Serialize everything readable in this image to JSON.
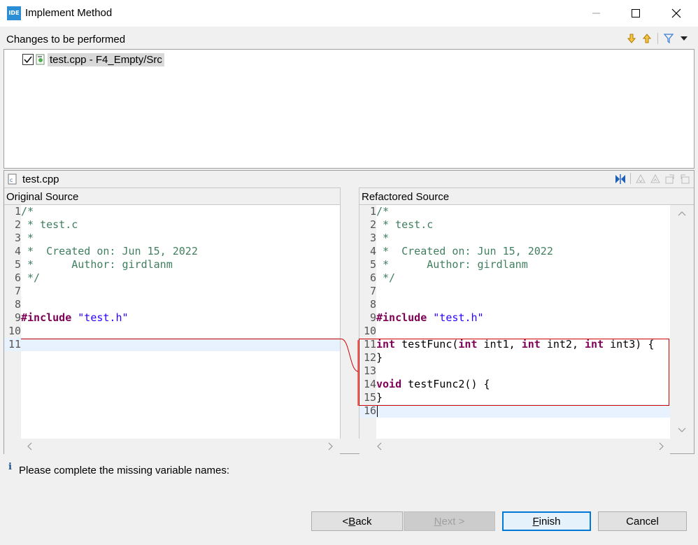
{
  "window": {
    "title": "Implement Method",
    "app_icon_text": "IDE"
  },
  "changes": {
    "header": "Changes to be performed",
    "items": [
      {
        "label": "test.cpp - F4_Empty/Src",
        "checked": true
      }
    ]
  },
  "compare": {
    "file_name": "test.cpp",
    "left_header": "Original Source",
    "right_header": "Refactored Source",
    "left_lines": [
      {
        "n": "1",
        "text": "/*",
        "type": "comment"
      },
      {
        "n": "2",
        "text": " * test.c",
        "type": "comment"
      },
      {
        "n": "3",
        "text": " *",
        "type": "comment"
      },
      {
        "n": "4",
        "text": " *  Created on: Jun 15, 2022",
        "type": "comment"
      },
      {
        "n": "5",
        "text": " *      Author: girdlanm",
        "type": "comment"
      },
      {
        "n": "6",
        "text": " */",
        "type": "comment"
      },
      {
        "n": "7",
        "text": "",
        "type": "plain"
      },
      {
        "n": "8",
        "text": "",
        "type": "plain"
      },
      {
        "n": "9",
        "kw": "#include",
        "str": " \"test.h\"",
        "type": "include"
      },
      {
        "n": "10",
        "text": "",
        "type": "plain"
      },
      {
        "n": "11",
        "text": "",
        "type": "plain",
        "highlight": true
      }
    ],
    "right_lines": [
      {
        "n": "1",
        "text": "/*",
        "type": "comment"
      },
      {
        "n": "2",
        "text": " * test.c",
        "type": "comment"
      },
      {
        "n": "3",
        "text": " *",
        "type": "comment"
      },
      {
        "n": "4",
        "text": " *  Created on: Jun 15, 2022",
        "type": "comment"
      },
      {
        "n": "5",
        "text": " *      Author: girdlanm",
        "type": "comment"
      },
      {
        "n": "6",
        "text": " */",
        "type": "comment"
      },
      {
        "n": "7",
        "text": "",
        "type": "plain"
      },
      {
        "n": "8",
        "text": "",
        "type": "plain"
      },
      {
        "n": "9",
        "kw": "#include",
        "str": " \"test.h\"",
        "type": "include"
      },
      {
        "n": "10",
        "text": "",
        "type": "plain"
      },
      {
        "n": "11",
        "type": "func",
        "parts": [
          [
            "kw",
            "int"
          ],
          [
            "p",
            " testFunc("
          ],
          [
            "kw",
            "int"
          ],
          [
            "p",
            " int1, "
          ],
          [
            "kw",
            "int"
          ],
          [
            "p",
            " int2, "
          ],
          [
            "kw",
            "int"
          ],
          [
            "p",
            " int3) {"
          ]
        ]
      },
      {
        "n": "12",
        "text": "}",
        "type": "plain"
      },
      {
        "n": "13",
        "text": "",
        "type": "plain"
      },
      {
        "n": "14",
        "type": "func",
        "parts": [
          [
            "kw",
            "void"
          ],
          [
            "p",
            " testFunc2() {"
          ]
        ]
      },
      {
        "n": "15",
        "text": "}",
        "type": "plain"
      },
      {
        "n": "16",
        "text": "",
        "type": "plain",
        "highlight": true
      }
    ]
  },
  "message": {
    "icon": "info-icon",
    "text": "Please complete the missing variable names:"
  },
  "buttons": {
    "back": {
      "pre": "< ",
      "mn": "B",
      "post": "ack"
    },
    "next": {
      "pre": "",
      "mn": "N",
      "post": "ext >"
    },
    "finish": {
      "pre": "",
      "mn": "F",
      "post": "inish"
    },
    "cancel": "Cancel"
  },
  "colors": {
    "diff_border": "#d00000",
    "highlight": "#e8f2fe",
    "default_button": "#0078d7"
  }
}
